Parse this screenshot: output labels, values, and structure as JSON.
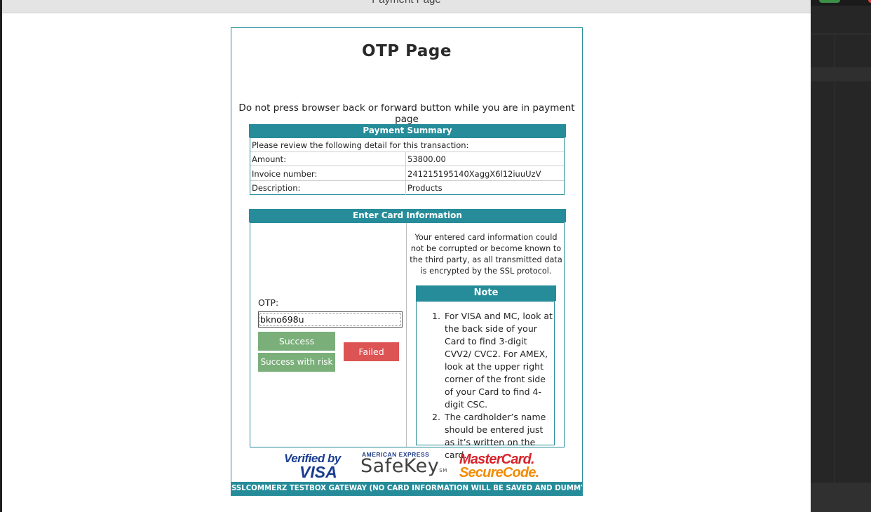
{
  "window": {
    "title": "Payment Page"
  },
  "page": {
    "title": "OTP Page",
    "warning": "Do not press browser back or forward button while you are in payment page"
  },
  "summary": {
    "header": "Payment Summary",
    "intro": "Please review the following detail for this transaction:",
    "rows": [
      {
        "label": "Amount:",
        "value": "53800.00"
      },
      {
        "label": "Invoice number:",
        "value": "241215195140XaggX6l12iuuUzV"
      },
      {
        "label": "Description:",
        "value": "Products"
      }
    ]
  },
  "card": {
    "header": "Enter Card Information",
    "otp_label": "OTP:",
    "otp_value": "bkno698u",
    "success_label": "Success",
    "success_risk_label": "Success with risk",
    "failed_label": "Failed",
    "ssl_note": "Your entered card information could not be corrupted or become known to the third party, as all transmitted data is encrypted by the SSL protocol.",
    "note_header": "Note",
    "notes": [
      {
        "num": "1.",
        "text": "For VISA and MC, look at the back side of your Card to find 3-digit CVV2/ CVC2. For AMEX, look at the upper right corner of the front side of your Card to find 4-digit CSC."
      },
      {
        "num": "2.",
        "text": "The cardholder’s name should be entered just as it’s written on the card."
      }
    ]
  },
  "logos": {
    "visa_line1": "Verified by",
    "visa_line2": "VISA",
    "amex_line1": "AMERICAN EXPRESS",
    "amex_line2": "SafeKey",
    "amex_sm": "SM",
    "mc_line1": "MasterCard.",
    "mc_line2": "SecureCode."
  },
  "footer": {
    "text": "SSLCOMMERZ TESTBOX GATEWAY (NO CARD INFORMATION WILL BE SAVED AND DUMMY CARD"
  },
  "colors": {
    "accent": "#268c99",
    "success": "#7aaf7a",
    "failed": "#dc5454"
  }
}
